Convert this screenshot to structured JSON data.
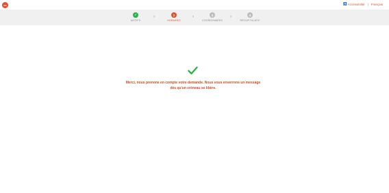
{
  "header": {
    "logo_text": "RA",
    "accessibility_label": "Accessibilité",
    "separator": "|",
    "language": "Français"
  },
  "steps": [
    {
      "label": "MOTIFS",
      "status": "done",
      "symbol": "✓"
    },
    {
      "label": "HORAIRES",
      "status": "current",
      "symbol": "2"
    },
    {
      "label": "COORDONNÉES",
      "status": "pending",
      "symbol": "3"
    },
    {
      "label": "RÉCAPITULATIF",
      "status": "pending",
      "symbol": "4"
    }
  ],
  "colors": {
    "done": "#2bb24c",
    "current": "#e0522d",
    "pending": "#bdbdbd",
    "accent": "#d04a1c"
  },
  "main": {
    "message_line1": "Merci, nous prenons en compte votre demande. Nous vous enverrons un message",
    "message_line2": "dès qu'un créneau se libère."
  }
}
